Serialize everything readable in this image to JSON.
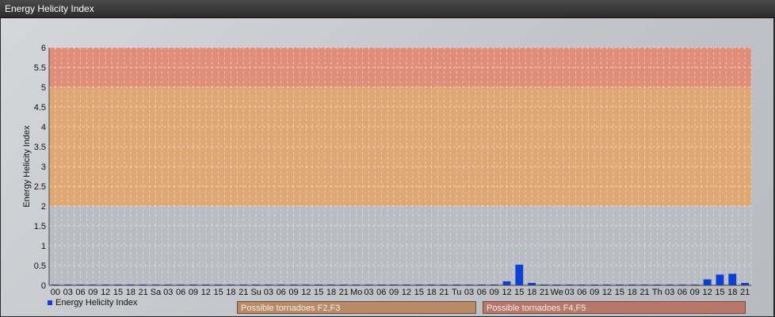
{
  "window": {
    "title": "Energy Helicity Index"
  },
  "legend": {
    "label": "Energy Helicity Index",
    "color": "#0b3fd6"
  },
  "zones": [
    {
      "label": "Possible tornadoes F2,F3",
      "from": 2,
      "to": 5,
      "color": "#e3a46a",
      "label_bg": "#b98a68"
    },
    {
      "label": "Possible tornadoes F4,F5",
      "from": 5,
      "to": 6,
      "color": "#e48872",
      "label_bg": "#b9766a"
    }
  ],
  "chart_data": {
    "type": "bar",
    "title": "",
    "ylabel": "Energy Helicity Index",
    "ylim": [
      0,
      6
    ],
    "yticks": [
      "0",
      "0.5",
      "1",
      "1.5",
      "2",
      "2.5",
      "3",
      "3.5",
      "4",
      "4.5",
      "5",
      "5.5",
      "6"
    ],
    "categories": [
      "00",
      "03",
      "06",
      "09",
      "12",
      "15",
      "18",
      "21",
      "Sa",
      "03",
      "06",
      "09",
      "12",
      "15",
      "18",
      "21",
      "Su",
      "03",
      "06",
      "09",
      "12",
      "15",
      "18",
      "21",
      "Mo",
      "03",
      "06",
      "09",
      "12",
      "15",
      "18",
      "21",
      "Tu",
      "03",
      "06",
      "09",
      "12",
      "15",
      "18",
      "21",
      "We",
      "03",
      "06",
      "09",
      "12",
      "15",
      "18",
      "21",
      "Th",
      "03",
      "06",
      "09",
      "12",
      "15",
      "18",
      "21"
    ],
    "values": [
      0.02,
      0.02,
      0.02,
      0.02,
      0.02,
      0.02,
      0.02,
      0.02,
      0.02,
      0.02,
      0.02,
      0.02,
      0.02,
      0.02,
      0.02,
      0.02,
      0.02,
      0.02,
      0.02,
      0.02,
      0.02,
      0.02,
      0.02,
      0.02,
      0.02,
      0.02,
      0.02,
      0.02,
      0.02,
      0.02,
      0.02,
      0.02,
      0.02,
      0.02,
      0.02,
      0.02,
      0.1,
      0.52,
      0.06,
      0.02,
      0.02,
      0.02,
      0.02,
      0.02,
      0.02,
      0.02,
      0.02,
      0.02,
      0.02,
      0.02,
      0.02,
      0.02,
      0.15,
      0.27,
      0.29,
      0.06
    ],
    "bar_color": "#0b3fd6",
    "grid": true
  }
}
